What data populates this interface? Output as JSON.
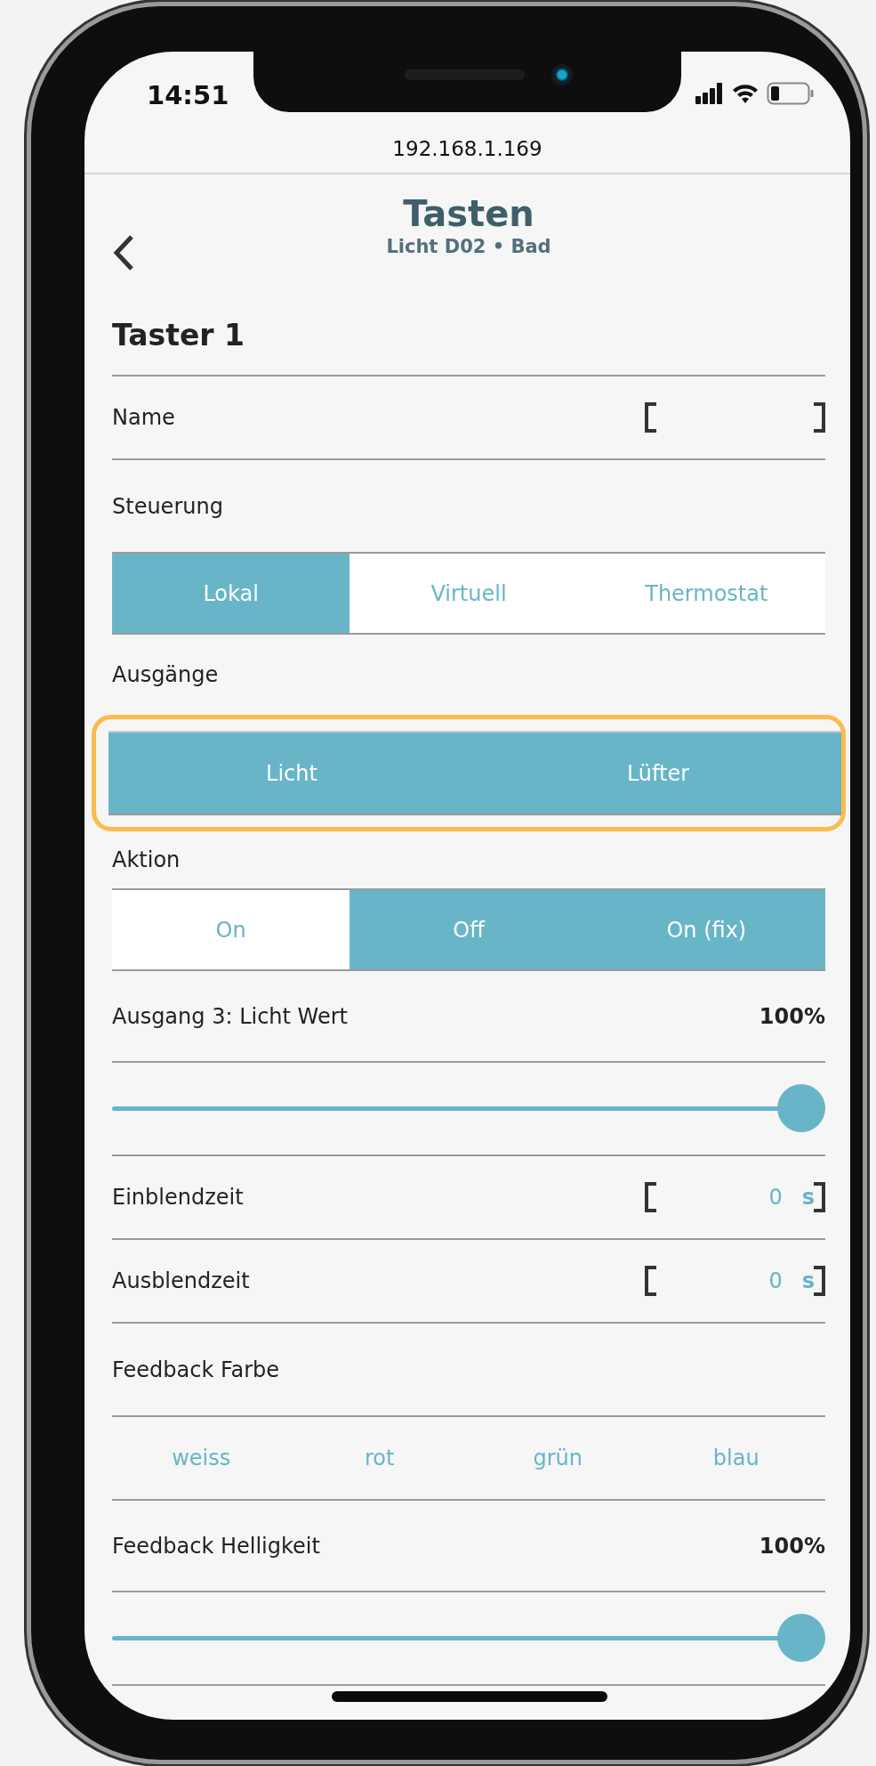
{
  "status_bar": {
    "time": "14:51"
  },
  "address_bar": {
    "url": "192.168.1.169"
  },
  "header": {
    "title": "Tasten",
    "subtitle": "Licht D02 • Bad"
  },
  "section_title": "Taster 1",
  "rows": [
    {
      "kind": "field",
      "label": "Name"
    },
    {
      "kind": "label",
      "label": "Steuerung"
    },
    {
      "kind": "segmented",
      "highlighted": false,
      "options": [
        {
          "label": "Lokal",
          "selected": true
        },
        {
          "label": "Virtuell",
          "selected": false
        },
        {
          "label": "Thermostat",
          "selected": false
        }
      ]
    },
    {
      "kind": "label",
      "label": "Ausgänge"
    },
    {
      "kind": "segmented",
      "highlighted": true,
      "options": [
        {
          "label": "Licht",
          "selected": true
        },
        {
          "label": "Lüfter",
          "selected": true
        }
      ]
    },
    {
      "kind": "label",
      "label": "Aktion"
    },
    {
      "kind": "segmented",
      "highlighted": false,
      "options": [
        {
          "label": "On",
          "selected": false
        },
        {
          "label": "Off",
          "selected": true
        },
        {
          "label": "On (fix)",
          "selected": true
        }
      ]
    },
    {
      "kind": "reading",
      "label": "Ausgang 3: Licht Wert",
      "reading": "100%"
    },
    {
      "kind": "slider",
      "level": 1
    },
    {
      "kind": "field",
      "label": "Einblendzeit",
      "value": "0",
      "unit": "s"
    },
    {
      "kind": "field",
      "label": "Ausblendzeit",
      "value": "0",
      "unit": "s"
    },
    {
      "kind": "label",
      "label": "Feedback Farbe"
    },
    {
      "kind": "choices",
      "options": [
        {
          "label": "weiss"
        },
        {
          "label": "rot"
        },
        {
          "label": "grün"
        },
        {
          "label": "blau"
        }
      ]
    },
    {
      "kind": "reading",
      "label": "Feedback Helligkeit",
      "reading": "100%"
    },
    {
      "kind": "slider",
      "level": 1
    }
  ]
}
